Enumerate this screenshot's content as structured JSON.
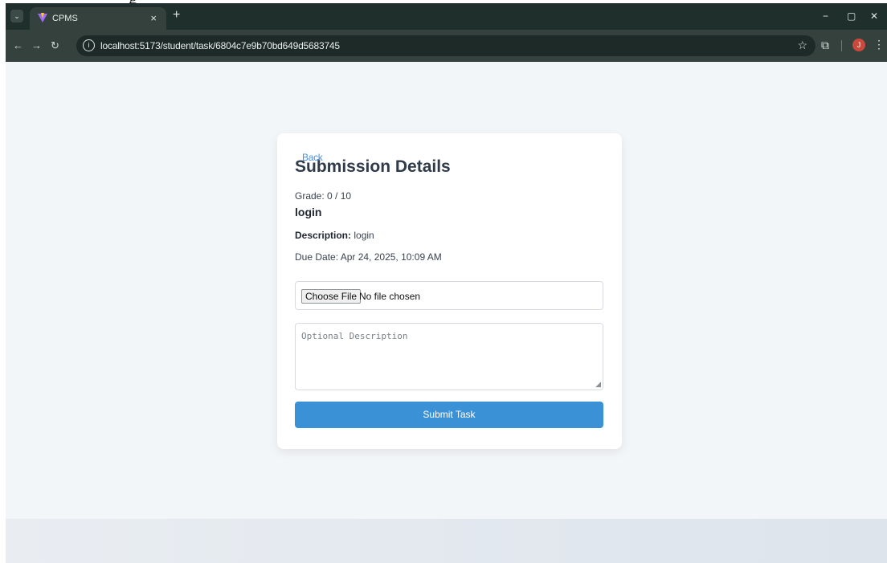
{
  "stray_text": "g",
  "browser": {
    "tab_title": "CPMS",
    "tab_close": "×",
    "new_tab": "+",
    "window_controls": {
      "minimize": "−",
      "restore": "▢",
      "close": "✕"
    },
    "url": "localhost:5173/student/task/6804c7e9b70bd649d5683745",
    "profile_initial": "J"
  },
  "card": {
    "back_label": "Back",
    "heading": "Submission Details",
    "grade": "Grade: 0 / 10",
    "task_title": "login",
    "description_label": "Description:",
    "description_value": "login",
    "due_date": "Due Date: Apr 24, 2025, 10:09 AM",
    "file_button": "Choose File",
    "file_status": "No file chosen",
    "textarea_placeholder": "Optional Description",
    "submit_label": "Submit Task"
  },
  "colors": {
    "accent": "#3b91d6",
    "link": "#4a90d9",
    "page_background": "#f3f6f9"
  },
  "icons": [
    "dropdown-icon",
    "vite-logo-icon",
    "back-arrow-icon",
    "forward-arrow-icon",
    "reload-icon",
    "info-icon",
    "star-icon",
    "extensions-icon",
    "menu-dots-icon"
  ]
}
